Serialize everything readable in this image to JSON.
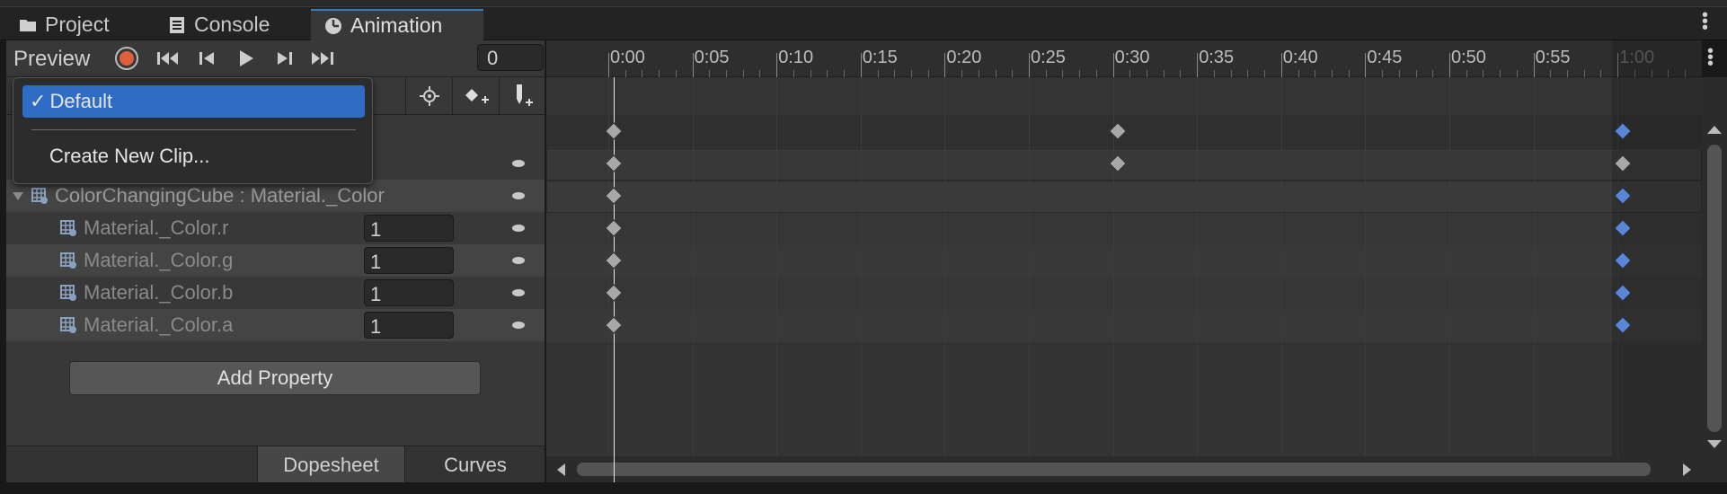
{
  "tabs": [
    {
      "label": "Project",
      "icon": "folder-icon"
    },
    {
      "label": "Console",
      "icon": "console-icon"
    },
    {
      "label": "Animation",
      "icon": "clock-icon",
      "active": true
    }
  ],
  "toolbar": {
    "preview_label": "Preview",
    "frame_value": "0"
  },
  "dropdown": {
    "selected_label": "Default",
    "check": "✓",
    "create_label": "Create New Clip..."
  },
  "tracks": {
    "group_label": "ColorChangingCube : Material._Color",
    "properties": [
      {
        "label": "Material._Color.r",
        "value": "1"
      },
      {
        "label": "Material._Color.g",
        "value": "1"
      },
      {
        "label": "Material._Color.b",
        "value": "1"
      },
      {
        "label": "Material._Color.a",
        "value": "1"
      }
    ]
  },
  "add_property_label": "Add Property",
  "view_tabs": {
    "dopesheet": "Dopesheet",
    "curves": "Curves"
  },
  "ruler": {
    "ticks": [
      "0:00",
      "0:05",
      "0:10",
      "0:15",
      "0:20",
      "0:25",
      "0:30",
      "0:35",
      "0:40",
      "0:45",
      "0:50",
      "0:55",
      "1:00"
    ]
  },
  "colors": {
    "accent": "#3a79bb",
    "selection": "#2f6cc6",
    "record": "#e0603c",
    "key_selected": "#5a86d6",
    "key_default": "#a8a8a8"
  }
}
